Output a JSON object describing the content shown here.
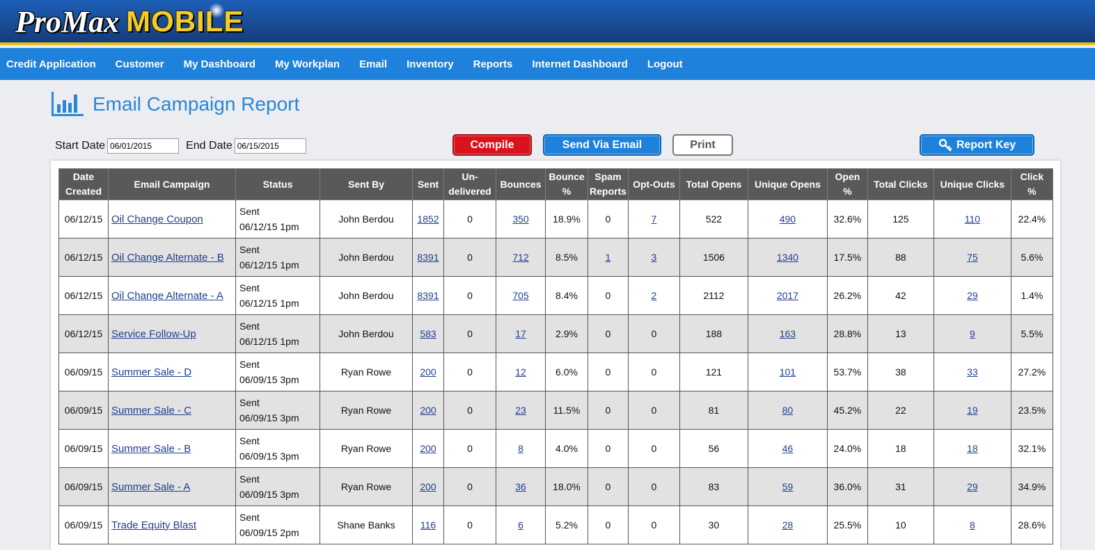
{
  "brand": {
    "pro": "ProMax",
    "mobile": "MOBILE"
  },
  "nav": [
    "Credit Application",
    "Customer",
    "My Dashboard",
    "My Workplan",
    "Email",
    "Inventory",
    "Reports",
    "Internet Dashboard",
    "Logout"
  ],
  "page": {
    "title": "Email Campaign Report"
  },
  "filters": {
    "start_label": "Start Date",
    "start_value": "06/01/2015",
    "end_label": "End Date",
    "end_value": "06/15/2015"
  },
  "buttons": {
    "compile": "Compile",
    "send": "Send Via Email",
    "print": "Print",
    "report_key": "Report Key"
  },
  "colors": {
    "header": "#1a4f9c",
    "nav": "#1e82dc",
    "accent_gold": "#f3cc2a",
    "compile_red": "#d9121c"
  },
  "table": {
    "headers": [
      [
        "Date",
        "Created"
      ],
      [
        "Email Campaign"
      ],
      [
        "Status"
      ],
      [
        "Sent By"
      ],
      [
        "Sent"
      ],
      [
        "Un-",
        "delivered"
      ],
      [
        "Bounces"
      ],
      [
        "Bounce",
        "%"
      ],
      [
        "Spam",
        "Reports"
      ],
      [
        "Opt-Outs"
      ],
      [
        "Total Opens"
      ],
      [
        "Unique Opens"
      ],
      [
        "Open",
        "%"
      ],
      [
        "Total Clicks"
      ],
      [
        "Unique Clicks"
      ],
      [
        "Click",
        "%"
      ]
    ],
    "rows": [
      [
        "06/12/15",
        "Oil Change Coupon",
        "Sent",
        "06/12/15 1pm",
        "John Berdou",
        "1852",
        "0",
        "350",
        "18.9%",
        "0",
        "7",
        "522",
        "490",
        "32.6%",
        "125",
        "110",
        "22.4%"
      ],
      [
        "06/12/15",
        "Oil Change Alternate - B",
        "Sent",
        "06/12/15 1pm",
        "John Berdou",
        "8391",
        "0",
        "712",
        "8.5%",
        "1",
        "3",
        "1506",
        "1340",
        "17.5%",
        "88",
        "75",
        "5.6%"
      ],
      [
        "06/12/15",
        "Oil Change Alternate - A",
        "Sent",
        "06/12/15 1pm",
        "John Berdou",
        "8391",
        "0",
        "705",
        "8.4%",
        "0",
        "2",
        "2112",
        "2017",
        "26.2%",
        "42",
        "29",
        "1.4%"
      ],
      [
        "06/12/15",
        "Service Follow-Up",
        "Sent",
        "06/12/15 1pm",
        "John Berdou",
        "583",
        "0",
        "17",
        "2.9%",
        "0",
        "0",
        "188",
        "163",
        "28.8%",
        "13",
        "9",
        "5.5%"
      ],
      [
        "06/09/15",
        "Summer Sale - D",
        "Sent",
        "06/09/15 3pm",
        "Ryan Rowe",
        "200",
        "0",
        "12",
        "6.0%",
        "0",
        "0",
        "121",
        "101",
        "53.7%",
        "38",
        "33",
        "27.2%"
      ],
      [
        "06/09/15",
        "Summer Sale - C",
        "Sent",
        "06/09/15 3pm",
        "Ryan Rowe",
        "200",
        "0",
        "23",
        "11.5%",
        "0",
        "0",
        "81",
        "80",
        "45.2%",
        "22",
        "19",
        "23.5%"
      ],
      [
        "06/09/15",
        "Summer Sale - B",
        "Sent",
        "06/09/15 3pm",
        "Ryan Rowe",
        "200",
        "0",
        "8",
        "4.0%",
        "0",
        "0",
        "56",
        "46",
        "24.0%",
        "18",
        "18",
        "32.1%"
      ],
      [
        "06/09/15",
        "Summer Sale - A",
        "Sent",
        "06/09/15 3pm",
        "Ryan Rowe",
        "200",
        "0",
        "36",
        "18.0%",
        "0",
        "0",
        "83",
        "59",
        "36.0%",
        "31",
        "29",
        "34.9%"
      ],
      [
        "06/09/15",
        "Trade Equity Blast",
        "Sent",
        "06/09/15 2pm",
        "Shane Banks",
        "116",
        "0",
        "6",
        "5.2%",
        "0",
        "0",
        "30",
        "28",
        "25.5%",
        "10",
        "8",
        "28.6%"
      ]
    ]
  }
}
